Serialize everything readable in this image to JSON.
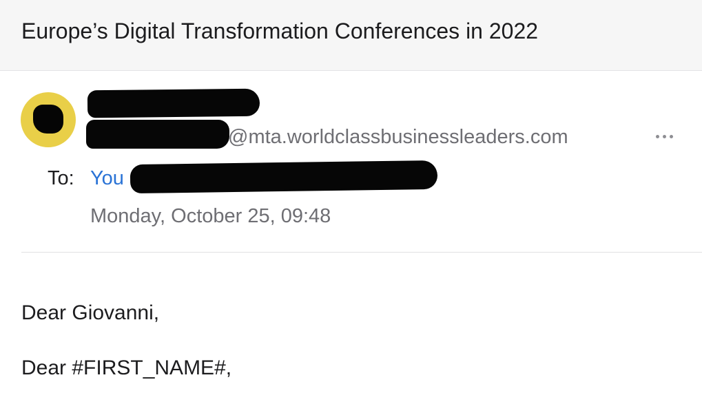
{
  "email": {
    "subject": "Europe’s Digital Transformation Conferences in 2022",
    "sender": {
      "email_domain": "@mta.worldclassbusinessleaders.com",
      "avatar_color": "#e9cf48"
    },
    "recipients": {
      "to_label": "To:",
      "to_name": "You"
    },
    "date": "Monday, October 25, 09:48",
    "body": {
      "greeting_1": "Dear Giovanni,",
      "greeting_2": "Dear #FIRST_NAME#,"
    }
  },
  "colors": {
    "link": "#2a73d6",
    "secondary_text": "#6e6e73",
    "header_background": "#f6f6f6"
  }
}
